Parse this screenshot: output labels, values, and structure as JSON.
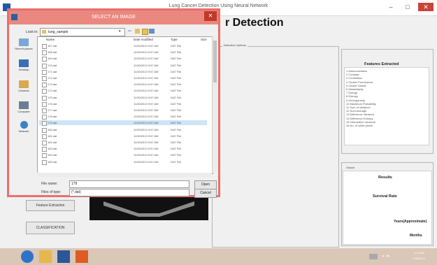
{
  "window": {
    "title": "Lung Cancer Detection Using Neural Network",
    "minimize": "–",
    "maximize": "□",
    "close": "✕"
  },
  "app": {
    "heading": "r Detection"
  },
  "group_label": "Detection Options",
  "features": {
    "title": "Features Extracted",
    "items": [
      "1 Autocorrelation",
      "2 Contrast",
      "3 Correlation",
      "4 Cluster Prominence",
      "5 Cluster Shade",
      "6 Dissimilarity",
      "7 Energy",
      "8 Entropy",
      "9 Homogeneity",
      "10 Maximum Probability",
      "11 Sum of Variance",
      "12 Sum Average",
      "13 Difference Variance",
      "14 Difference Entropy",
      "15 Information measure",
      "16 No. of white pixels"
    ]
  },
  "output": {
    "label": "Output",
    "results_title": "Results",
    "survival_rate": "Survival Rate",
    "years": "Years(Approximate)",
    "months": "Months"
  },
  "buttons": {
    "feature_extraction": "Feature Extraction",
    "classification": "CLASSIFICATION"
  },
  "dialog": {
    "title": "SELECT AN IMAGE",
    "close": "✕",
    "look_in_label": "Look in:",
    "look_in_value": "lung_sample",
    "places": [
      "Recent places",
      "Desktop",
      "Libraries",
      "Computer",
      "Network"
    ],
    "columns": {
      "name": "Name",
      "date": "Date modified",
      "type": "Type",
      "size": "Size"
    },
    "files": [
      {
        "name": "167.dat",
        "date": "11/30/2013 9:57 AM",
        "type": "DAT File"
      },
      {
        "name": "168.dat",
        "date": "11/30/2013 9:57 AM",
        "type": "DAT File"
      },
      {
        "name": "169.dat",
        "date": "11/30/2013 9:57 AM",
        "type": "DAT File"
      },
      {
        "name": "170.dat",
        "date": "11/30/2013 9:57 AM",
        "type": "DAT File"
      },
      {
        "name": "171.dat",
        "date": "11/30/2013 9:57 AM",
        "type": "DAT File"
      },
      {
        "name": "172.dat",
        "date": "11/30/2013 9:57 AM",
        "type": "DAT File"
      },
      {
        "name": "173.dat",
        "date": "11/30/2013 9:57 AM",
        "type": "DAT File"
      },
      {
        "name": "174.dat",
        "date": "11/30/2013 9:57 AM",
        "type": "DAT File"
      },
      {
        "name": "175.dat",
        "date": "11/30/2013 9:57 AM",
        "type": "DAT File"
      },
      {
        "name": "176.dat",
        "date": "11/30/2013 9:57 AM",
        "type": "DAT File"
      },
      {
        "name": "177.dat",
        "date": "11/30/2013 9:57 AM",
        "type": "DAT File"
      },
      {
        "name": "178.dat",
        "date": "11/30/2013 9:57 AM",
        "type": "DAT File"
      },
      {
        "name": "179.dat",
        "date": "11/30/2013 9:57 AM",
        "type": "DAT File"
      },
      {
        "name": "180.dat",
        "date": "11/30/2013 9:57 AM",
        "type": "DAT File"
      },
      {
        "name": "181.dat",
        "date": "11/30/2013 9:57 AM",
        "type": "DAT File"
      },
      {
        "name": "182.dat",
        "date": "11/30/2013 9:57 AM",
        "type": "DAT File"
      },
      {
        "name": "183.dat",
        "date": "11/30/2013 9:57 AM",
        "type": "DAT File"
      },
      {
        "name": "184.dat",
        "date": "11/30/2013 9:57 AM",
        "type": "DAT File"
      },
      {
        "name": "185.dat",
        "date": "11/30/2013 9:57 AM",
        "type": "DAT File"
      }
    ],
    "selected_file": "179.dat",
    "file_name_label": "File name:",
    "file_name_value": "179",
    "files_of_type_label": "Files of type:",
    "files_of_type_value": "(*.dat)",
    "open": "Open",
    "cancel": "Cancel"
  },
  "taskbar": {
    "time": "1:01 AM",
    "date": "7/26/2014"
  }
}
